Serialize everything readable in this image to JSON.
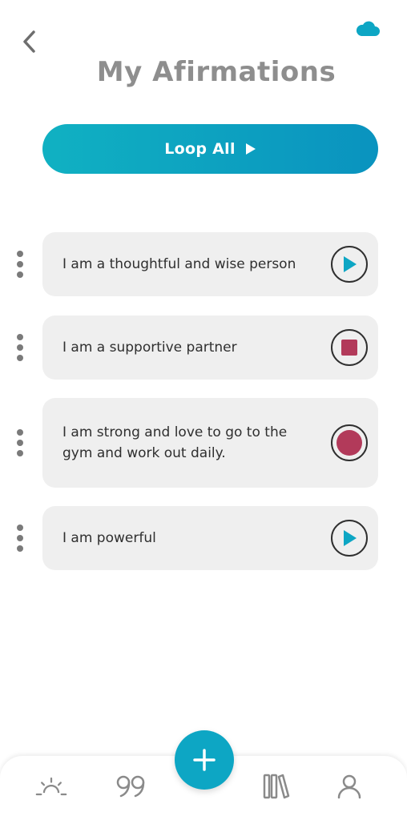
{
  "header": {
    "title": "My Afirmations",
    "back_icon": "chevron-left-icon",
    "cloud_icon": "cloud-icon",
    "accent_color": "#0da6c4"
  },
  "loop_button": {
    "label": "Loop All",
    "icon": "play-icon"
  },
  "affirmations": [
    {
      "text": "I am a thoughtful  and wise person",
      "action": "play",
      "icon": "play-icon"
    },
    {
      "text": "I am a supportive partner",
      "action": "stop",
      "icon": "stop-icon"
    },
    {
      "text": "I am strong and love to go to the gym and work out daily.",
      "action": "record",
      "icon": "record-icon"
    },
    {
      "text": "I am powerful",
      "action": "play",
      "icon": "play-icon"
    }
  ],
  "tabbar": {
    "items": [
      {
        "name": "sunrise-icon"
      },
      {
        "name": "quote-icon"
      },
      {
        "name": "add-icon"
      },
      {
        "name": "library-icon"
      },
      {
        "name": "profile-icon"
      }
    ]
  },
  "colors": {
    "play": "#0da6c4",
    "stop": "#b23a5a",
    "record": "#b23a5a",
    "card_bg": "#efefef",
    "title": "#8e8e8e"
  }
}
